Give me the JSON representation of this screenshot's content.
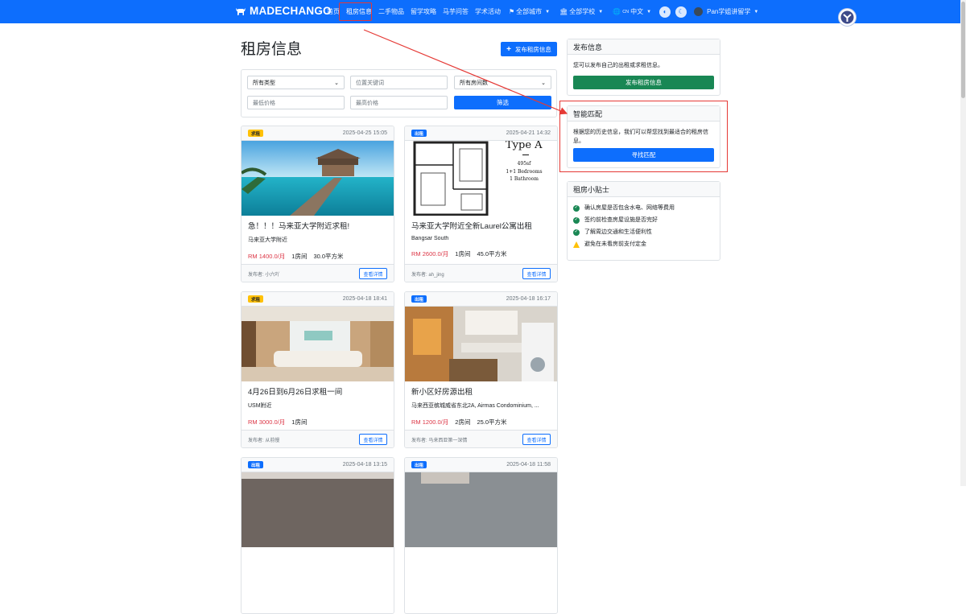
{
  "brand": {
    "name": "MADECHANGO"
  },
  "nav": {
    "items": [
      {
        "label": "首页"
      },
      {
        "label": "租房信息"
      },
      {
        "label": "二手物品"
      },
      {
        "label": "留学攻略"
      },
      {
        "label": "马芋问答"
      },
      {
        "label": "学术活动"
      }
    ],
    "city_label": "全部城市",
    "school_label": "全部学校",
    "lang_code": "CN",
    "lang_label": "中文",
    "user_label": "Pan学姐讲留学"
  },
  "page": {
    "title": "租房信息",
    "publish_button": "发布租房信息"
  },
  "filter": {
    "type_select": "所有类型",
    "keyword_placeholder": "位置关键词",
    "rooms_select": "所有房间数",
    "min_price_placeholder": "最低价格",
    "max_price_placeholder": "最高价格",
    "submit_label": "筛选"
  },
  "listings": [
    {
      "badge": "求租",
      "badge_type": "seek",
      "date": "2025-04-25 15:05",
      "title": "急！！！马来亚大学附近求租!",
      "location": "马来亚大学附近",
      "price": "RM 1400.0/月",
      "rooms": "1房间",
      "area": "30.0平方米",
      "poster": "发布者: 小六吖",
      "detail_label": "查看详情",
      "image": "beach-pier"
    },
    {
      "badge": "出租",
      "badge_type": "rent",
      "date": "2025-04-21 14:32",
      "title": "马来亚大学附近全新Laurel公寓出租",
      "location": "Bangsar South",
      "price": "RM 2600.0/月",
      "rooms": "1房间",
      "area": "45.0平方米",
      "poster": "发布者: ah_jing",
      "detail_label": "查看详情",
      "image": "floor-plan",
      "plan_title": "Type A",
      "plan_lines": [
        "495sf",
        "1+1 Bedrooms",
        "1 Bathroom"
      ]
    },
    {
      "badge": "求租",
      "badge_type": "seek",
      "date": "2025-04-18 18:41",
      "title": "4月26日到6月26日求租一间",
      "location": "USM附近",
      "price": "RM 3000.0/月",
      "rooms": "1房间",
      "area": "",
      "poster": "发布者: 从前慢",
      "detail_label": "查看详情",
      "image": "clinic-lobby"
    },
    {
      "badge": "出租",
      "badge_type": "rent",
      "date": "2025-04-18 16:17",
      "title": "新小区好房源出租",
      "location": "马来西亚槟城威省东北2A, Airmas Condominium, ...",
      "price": "RM 1200.0/月",
      "rooms": "2房间",
      "area": "25.0平方米",
      "poster": "发布者: 马来西亚第一深情",
      "detail_label": "查看详情",
      "image": "kitchen"
    },
    {
      "badge": "出租",
      "badge_type": "rent",
      "date": "2025-04-18 13:15",
      "image": "room-dark"
    },
    {
      "badge": "出租",
      "badge_type": "rent",
      "date": "2025-04-18 11:58",
      "image": "room-light"
    }
  ],
  "sidebar": {
    "publish": {
      "title": "发布信息",
      "text": "您可以发布自己的出租或求租信息。",
      "button": "发布租房信息"
    },
    "match": {
      "title": "智能匹配",
      "text": "根据您的历史信息，我们可以帮您找到最适合的租房信息。",
      "button": "寻找匹配"
    },
    "tips": {
      "title": "租房小贴士",
      "items": [
        {
          "text": "确认房屋是否包含水电、网络等费用",
          "icon": "check"
        },
        {
          "text": "签约前检查房屋设施是否完好",
          "icon": "check"
        },
        {
          "text": "了解周边交通和生活便利性",
          "icon": "check"
        },
        {
          "text": "避免在未看房前支付定金",
          "icon": "warning"
        }
      ]
    }
  },
  "colors": {
    "primary": "#0d6efd",
    "success": "#198754",
    "warning": "#ffc107",
    "danger": "#dc3545",
    "annotation": "#e53935"
  }
}
